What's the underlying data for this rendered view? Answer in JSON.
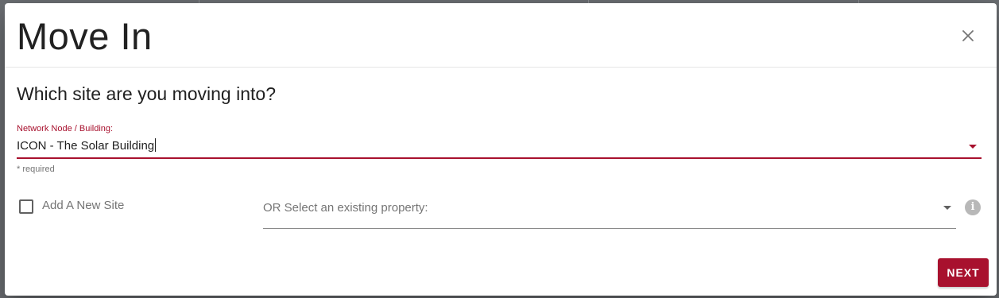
{
  "dialog": {
    "title": "Move In",
    "question": "Which site are you moving into?"
  },
  "network_field": {
    "label": "Network Node / Building:",
    "value": "ICON - The Solar Building",
    "hint": "* required"
  },
  "new_site": {
    "label": "Add A New Site",
    "checked": false
  },
  "property_select": {
    "placeholder": "OR Select an existing property:"
  },
  "actions": {
    "next_label": "NEXT"
  },
  "icons": {
    "close": "close-icon",
    "dropdown": "chevron-down-icon",
    "info": "info-icon"
  },
  "colors": {
    "accent": "#a8112e",
    "overlay": "#5f6368"
  }
}
